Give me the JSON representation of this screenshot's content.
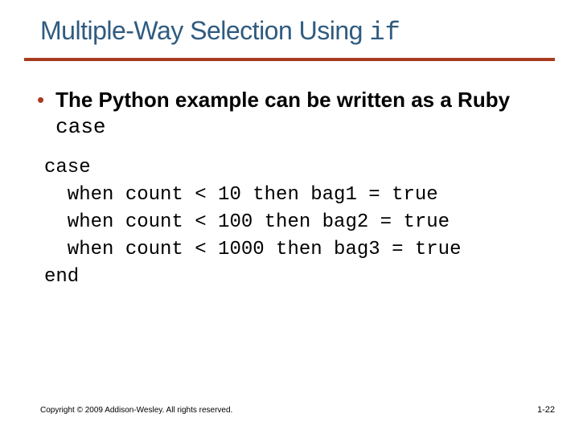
{
  "title": {
    "prefix": "Multiple-Way Selection Using ",
    "keyword": "if"
  },
  "bullet": {
    "marker": "•",
    "text_before": "The Python example can be written as a Ruby ",
    "keyword": "case"
  },
  "code": "case\n  when count < 10 then bag1 = true\n  when count < 100 then bag2 = true\n  when count < 1000 then bag3 = true\nend",
  "footer": {
    "copyright": "Copyright © 2009 Addison-Wesley. All rights reserved.",
    "page": "1-22"
  }
}
